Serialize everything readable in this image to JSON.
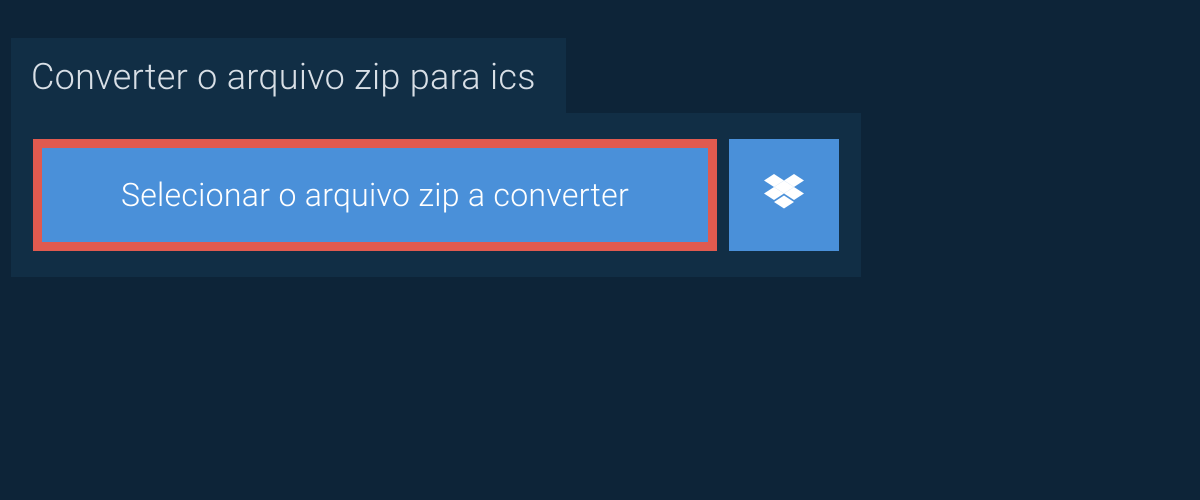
{
  "tab": {
    "title": "Converter o arquivo zip para ics"
  },
  "buttons": {
    "select_file": "Selecionar o arquivo zip a converter"
  }
}
